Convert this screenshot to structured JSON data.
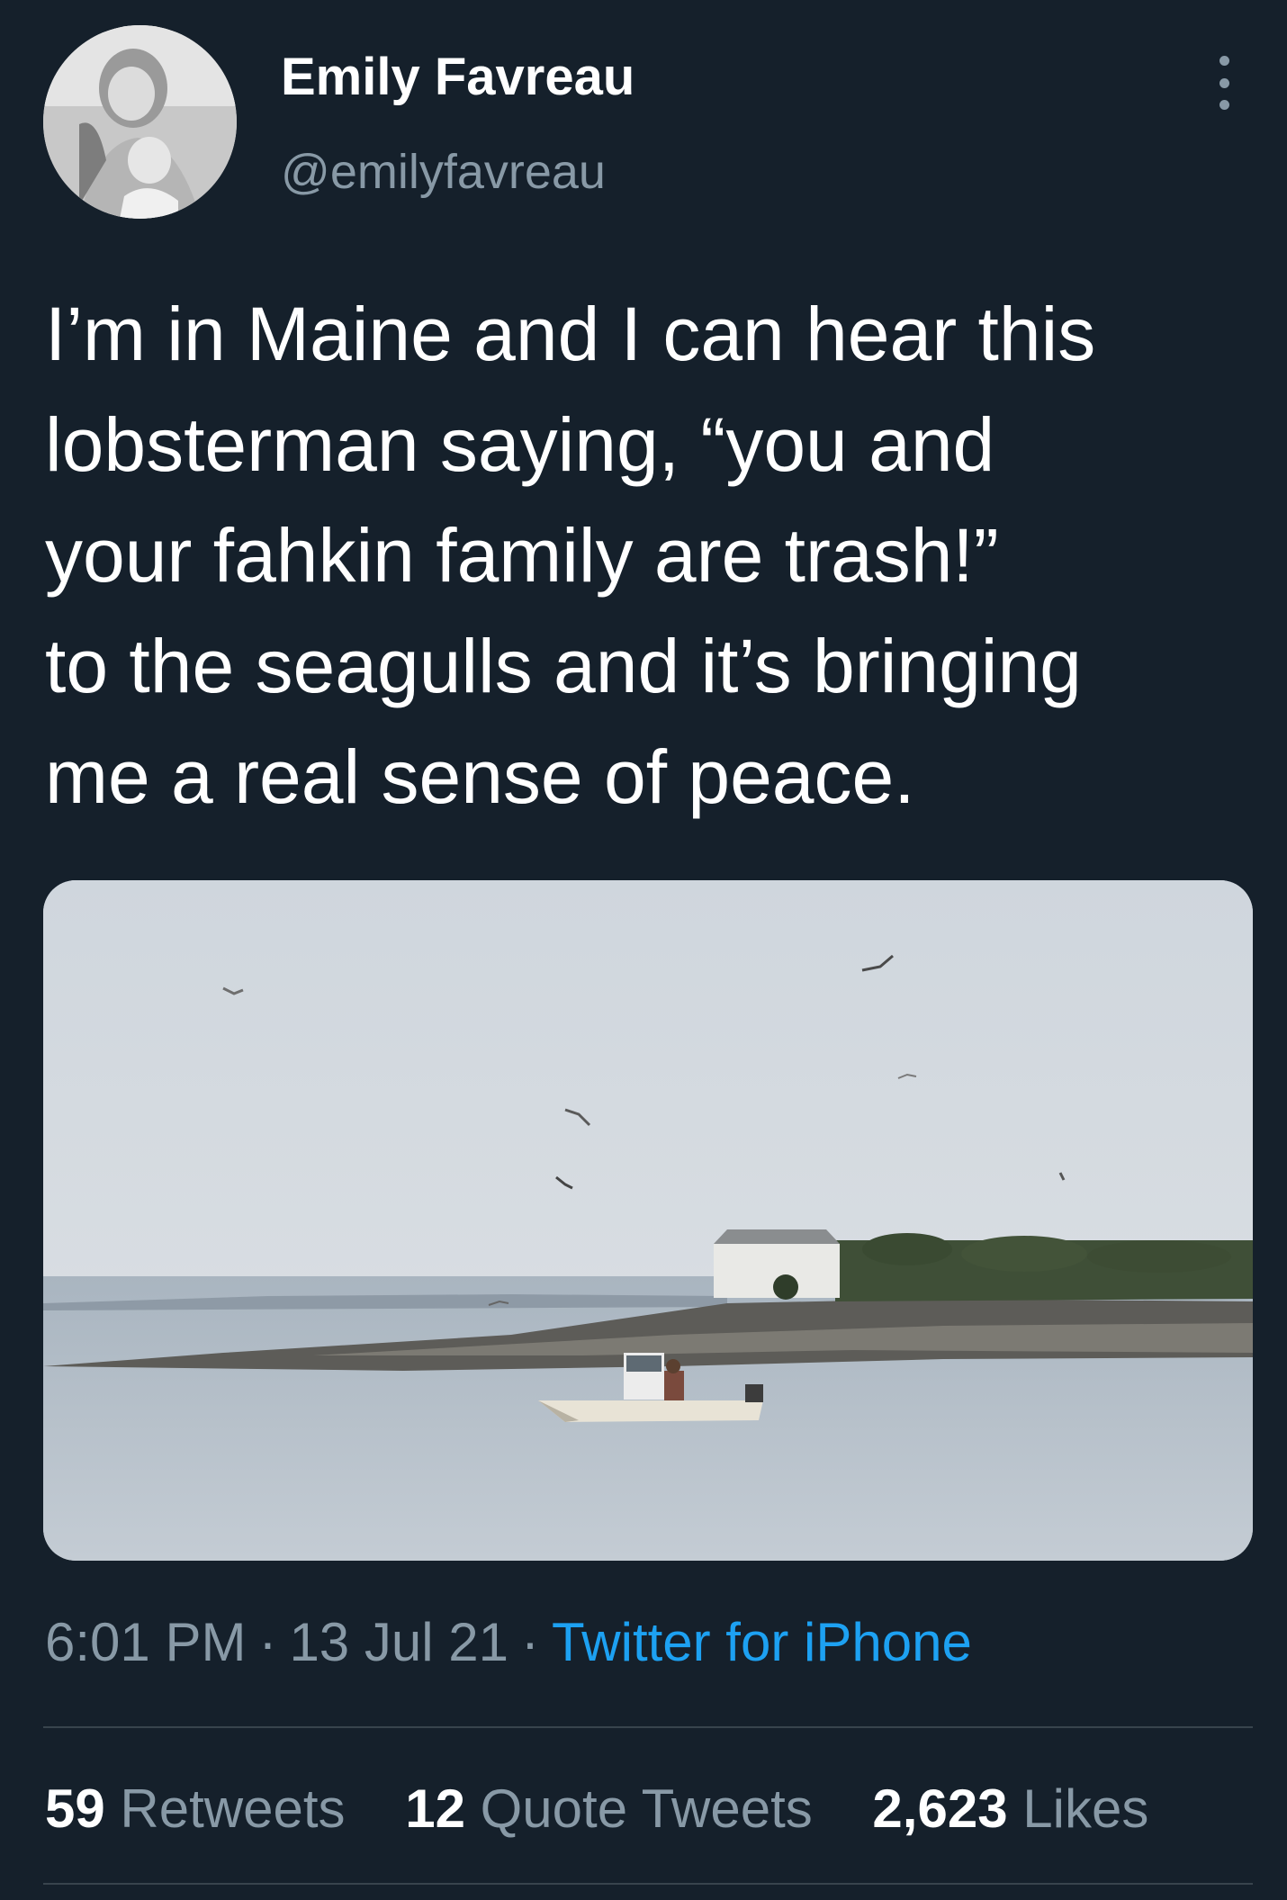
{
  "author": {
    "display_name": "Emily Favreau",
    "handle": "@emilyfavreau"
  },
  "tweet": {
    "text_lines": [
      "I’m in Maine and I can hear this",
      "lobsterman saying, “you and",
      "your fahkin family are trash!”",
      "to the seagulls and it’s bringing",
      "me a real sense of peace."
    ]
  },
  "meta": {
    "time": "6:01 PM",
    "separator": "·",
    "date": "13 Jul 21",
    "source": "Twitter for iPhone"
  },
  "stats": {
    "retweets_count": "59",
    "retweets_label": "Retweets",
    "quotes_count": "12",
    "quotes_label": "Quote Tweets",
    "likes_count": "2,623",
    "likes_label": "Likes"
  },
  "colors": {
    "background": "#15202b",
    "secondary_text": "#8899a6",
    "link": "#1da1f2",
    "divider": "#38444d"
  },
  "icons": {
    "more": "more-vertical-icon"
  }
}
